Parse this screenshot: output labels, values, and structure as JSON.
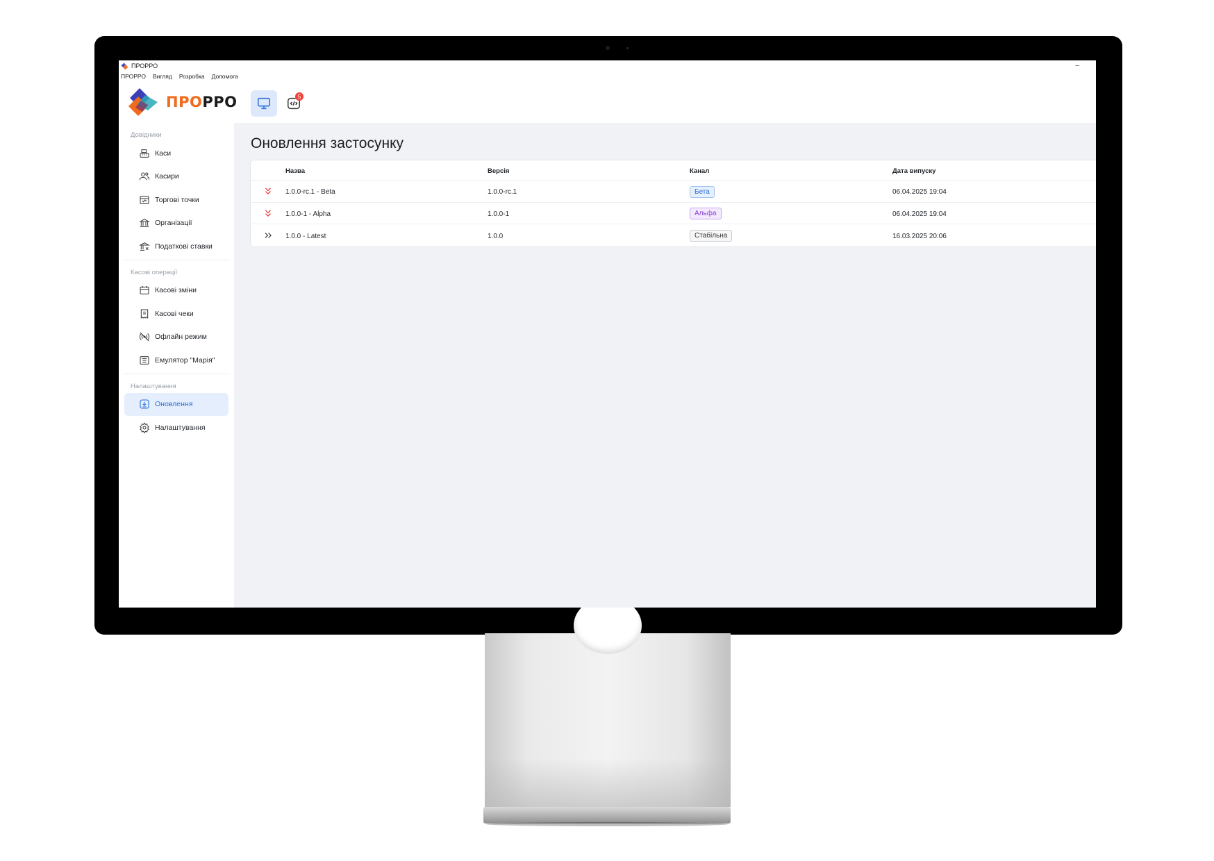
{
  "window": {
    "title": "ПРОРРО",
    "minimize": "–"
  },
  "menu": [
    "ПРОРРО",
    "Вигляд",
    "Розробка",
    "Допомога"
  ],
  "brand": {
    "part1": "ПРО",
    "part2": "РРО"
  },
  "header": {
    "badge_count": "5"
  },
  "sidebar": {
    "sections": [
      {
        "title": "Довідники",
        "items": [
          "Каси",
          "Касири",
          "Торгові точки",
          "Організації",
          "Податкові ставки"
        ]
      },
      {
        "title": "Касові операції",
        "items": [
          "Касові зміни",
          "Касові чеки",
          "Офлайн режим",
          "Емулятор \"Марія\""
        ]
      },
      {
        "title": "Налаштування",
        "items": [
          "Оновлення",
          "Налаштування"
        ]
      }
    ],
    "active_item": "Оновлення"
  },
  "page": {
    "title": "Оновлення застосунку"
  },
  "table": {
    "headers": [
      "Назва",
      "Версія",
      "Канал",
      "Дата випуску"
    ],
    "rows": [
      {
        "name": "1.0.0-rc.1 - Beta",
        "version": "1.0.0-rc.1",
        "channel": "Бета",
        "date": "06.04.2025 19:04",
        "icon": "double-chevron-down-icon"
      },
      {
        "name": "1.0.0-1 - Alpha",
        "version": "1.0.0-1",
        "channel": "Альфа",
        "date": "06.04.2025 19:04",
        "icon": "double-chevron-down-icon"
      },
      {
        "name": "1.0.0 - Latest",
        "version": "1.0.0",
        "channel": "Стабільна",
        "date": "16.03.2025 20:06",
        "icon": "double-chevron-right-icon"
      }
    ]
  },
  "colors": {
    "accent": "#2f6fd6",
    "brand_orange": "#f26a1b",
    "downgrade_red": "#e53935",
    "main_bg": "#f0f2f6"
  }
}
